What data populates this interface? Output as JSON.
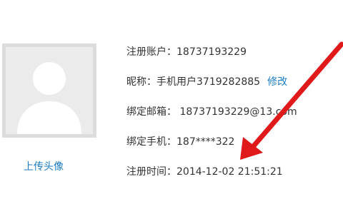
{
  "avatar": {
    "icon": "default-user-silhouette-icon",
    "upload_label": "上传头像"
  },
  "account": {
    "account_label": "注册账户：",
    "account_value": "18737193229",
    "nickname_label": "昵称：",
    "nickname_value": "手机用户3719282885",
    "edit_label": "修改",
    "email_label": "绑定邮箱：",
    "email_value": "18737193229@1",
    "email_suffix": "3.com",
    "phone_label": "绑定手机：",
    "phone_value": "187****322",
    "regtime_label": "注册时间：",
    "regtime_value": "2014-12-02 21:51:21"
  },
  "colors": {
    "link": "#1a7bc4",
    "annotation_arrow": "#e0191b"
  }
}
